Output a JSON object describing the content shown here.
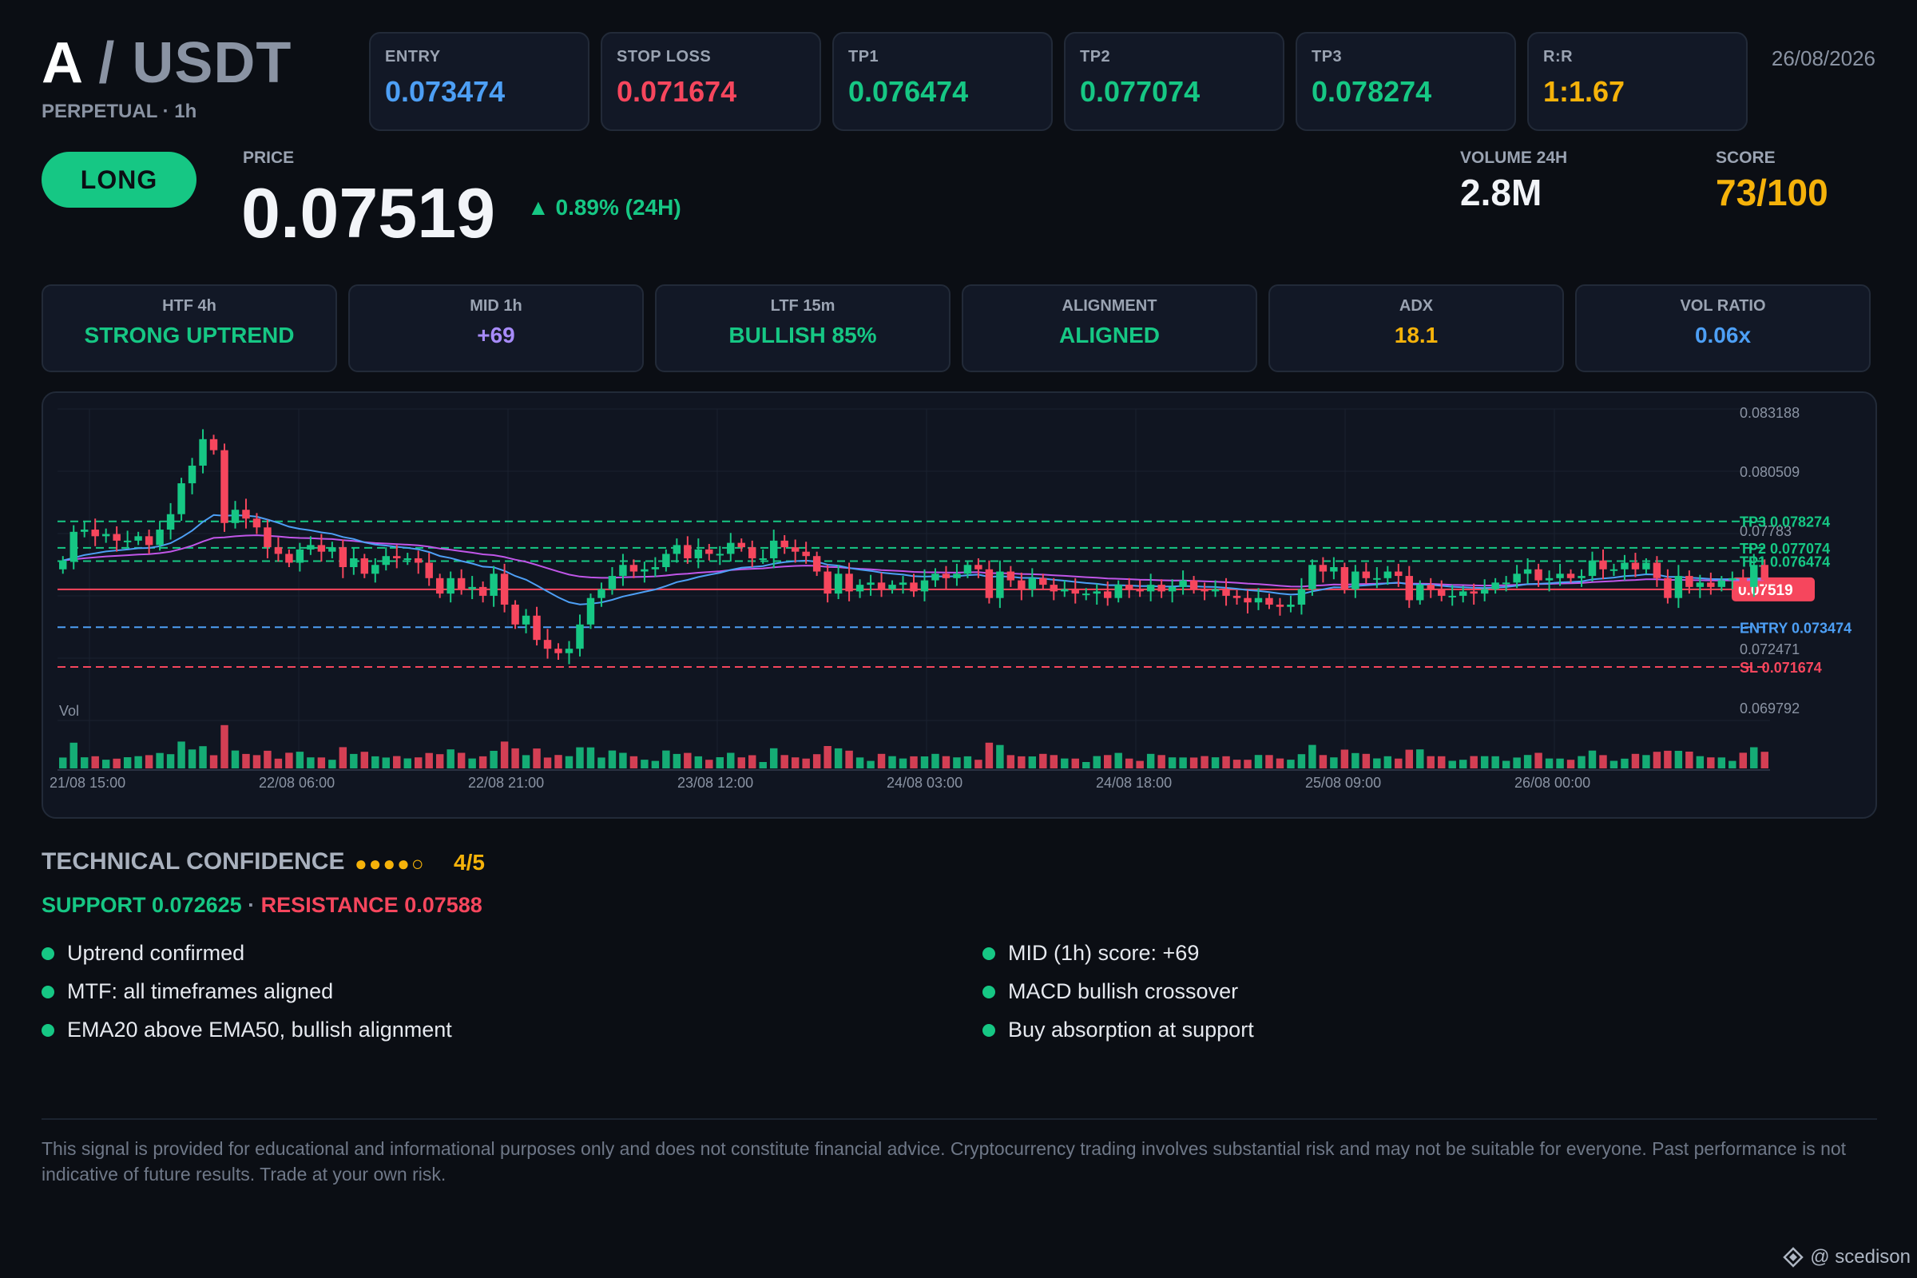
{
  "header": {
    "base": "A",
    "sep": "/",
    "quote": "USDT",
    "subtitle": "PERPETUAL · 1h",
    "date": "26/08/2026"
  },
  "levels": [
    {
      "label": "ENTRY",
      "value": "0.073474",
      "color": "#4d9ff5"
    },
    {
      "label": "STOP LOSS",
      "value": "0.071674",
      "color": "#f6465d"
    },
    {
      "label": "TP1",
      "value": "0.076474",
      "color": "#16c784"
    },
    {
      "label": "TP2",
      "value": "0.077074",
      "color": "#16c784"
    },
    {
      "label": "TP3",
      "value": "0.078274",
      "color": "#16c784"
    },
    {
      "label": "R:R",
      "value": "1:1.67",
      "color": "#f5b20a"
    }
  ],
  "signal": {
    "direction": "LONG",
    "price_label": "PRICE",
    "price": "0.07519",
    "change": "▲ 0.89% (24H)",
    "volume_label": "VOLUME 24H",
    "volume": "2.8M",
    "score_label": "SCORE",
    "score": "73/100"
  },
  "indicators": [
    {
      "label": "HTF 4h",
      "value": "STRONG UPTREND",
      "color": "#16c784"
    },
    {
      "label": "MID 1h",
      "value": "+69",
      "color": "#a78bfa"
    },
    {
      "label": "LTF 15m",
      "value": "BULLISH 85%",
      "color": "#16c784"
    },
    {
      "label": "ALIGNMENT",
      "value": "ALIGNED",
      "color": "#16c784"
    },
    {
      "label": "ADX",
      "value": "18.1",
      "color": "#f5b20a"
    },
    {
      "label": "VOL RATIO",
      "value": "0.06x",
      "color": "#4d9ff5"
    }
  ],
  "chart_data": {
    "type": "candlestick",
    "x_tick_labels": [
      "21/08 15:00",
      "22/08 06:00",
      "22/08 21:00",
      "23/08 12:00",
      "24/08 03:00",
      "24/08 18:00",
      "25/08 09:00",
      "26/08 00:00"
    ],
    "y_tick_labels": [
      "0.083188",
      "0.080509",
      "0.07783",
      "0.072471",
      "0.069792"
    ],
    "y_ticks": [
      0.083188,
      0.080509,
      0.07783,
      0.072471,
      0.069792
    ],
    "ylim": [
      0.069792,
      0.083188
    ],
    "volume_label": "Vol",
    "current_price_label": "0.07519",
    "current_price": 0.07519,
    "hlines": [
      {
        "label": "TP3 0.078274",
        "value": 0.078274,
        "color": "#16c784"
      },
      {
        "label": "TP2 0.077074",
        "value": 0.077074,
        "color": "#16c784"
      },
      {
        "label": "TP1 0.076474",
        "value": 0.076474,
        "color": "#16c784"
      },
      {
        "label": "ENTRY 0.073474",
        "value": 0.073474,
        "color": "#4d9ff5"
      },
      {
        "label": "SL 0.071674",
        "value": 0.071674,
        "color": "#f6465d"
      }
    ],
    "ohlc_close": [
      0.0765,
      0.0778,
      0.0779,
      0.0776,
      0.0777,
      0.0774,
      0.0774,
      0.0776,
      0.0772,
      0.0779,
      0.0786,
      0.08,
      0.0808,
      0.082,
      0.0815,
      0.0782,
      0.0788,
      0.0784,
      0.078,
      0.0771,
      0.0768,
      0.0764,
      0.077,
      0.0772,
      0.0769,
      0.0771,
      0.0762,
      0.0766,
      0.0759,
      0.0763,
      0.0767,
      0.0766,
      0.0766,
      0.0764,
      0.0757,
      0.075,
      0.0757,
      0.0752,
      0.0753,
      0.0749,
      0.0759,
      0.0745,
      0.0736,
      0.074,
      0.0729,
      0.0725,
      0.0723,
      0.0725,
      0.0736,
      0.0748,
      0.0752,
      0.0758,
      0.0763,
      0.076,
      0.0761,
      0.0762,
      0.0768,
      0.0772,
      0.0766,
      0.077,
      0.0768,
      0.0768,
      0.0773,
      0.0771,
      0.0766,
      0.0766,
      0.0774,
      0.0771,
      0.0769,
      0.0767,
      0.076,
      0.075,
      0.0759,
      0.0751,
      0.0754,
      0.0755,
      0.0752,
      0.0754,
      0.0755,
      0.0751,
      0.0756,
      0.0759,
      0.0757,
      0.0759,
      0.0763,
      0.0761,
      0.0748,
      0.076,
      0.0756,
      0.0752,
      0.0757,
      0.0754,
      0.0751,
      0.0752,
      0.075,
      0.075,
      0.0751,
      0.0748,
      0.0754,
      0.0752,
      0.0751,
      0.0754,
      0.0751,
      0.0753,
      0.0756,
      0.0752,
      0.0751,
      0.0752,
      0.0749,
      0.0748,
      0.0746,
      0.0748,
      0.0745,
      0.0744,
      0.0745,
      0.0752,
      0.0763,
      0.076,
      0.0762,
      0.0752,
      0.076,
      0.0757,
      0.0757,
      0.076,
      0.0758,
      0.0747,
      0.0754,
      0.0752,
      0.0749,
      0.0749,
      0.0751,
      0.075,
      0.0752,
      0.0755,
      0.0755,
      0.0759,
      0.0761,
      0.0756,
      0.0757,
      0.0759,
      0.0757,
      0.0758,
      0.0765,
      0.0761,
      0.0761,
      0.0764,
      0.0761,
      0.0764,
      0.0757,
      0.0748,
      0.0758,
      0.0753,
      0.0755,
      0.0753,
      0.0756,
      0.0757,
      0.0753,
      0.0763,
      0.0756
    ],
    "ema_fast_label": "EMA20",
    "ema_slow_label": "EMA50"
  },
  "confidence": {
    "title": "TECHNICAL CONFIDENCE",
    "dots": "●●●●○",
    "score": "4/5",
    "support": "SUPPORT 0.072625",
    "separator": "·",
    "resistance": "RESISTANCE 0.07588"
  },
  "reasons_left": [
    "Uptrend confirmed",
    "MTF: all timeframes aligned",
    "EMA20 above EMA50, bullish alignment"
  ],
  "reasons_right": [
    "MID (1h) score: +69",
    "MACD bullish crossover",
    "Buy absorption at support"
  ],
  "disclaimer": "This signal is provided for educational and informational purposes only and does not constitute financial advice. Cryptocurrency trading involves substantial risk and may not be suitable for everyone. Past performance is not indicative of future results. Trade at your own risk.",
  "handle": "@ scedison",
  "colors": {
    "green": "#16c784",
    "red": "#f6465d",
    "blue": "#4d9ff5",
    "gold": "#f5b20a",
    "purple": "#c056e8"
  }
}
